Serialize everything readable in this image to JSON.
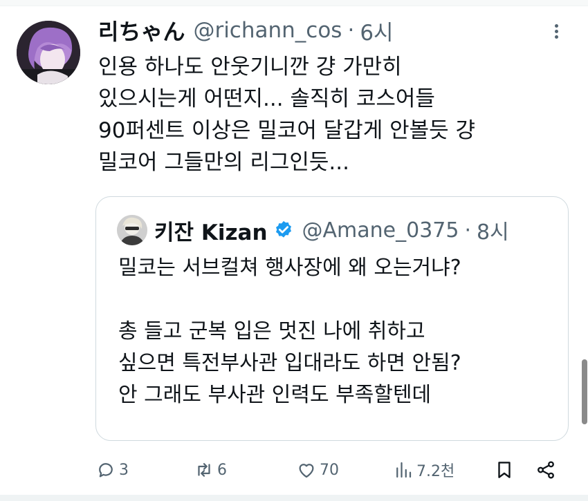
{
  "tweet": {
    "display_name": "리ちゃん",
    "handle": "@richann_cos",
    "separator": "·",
    "time": "6시",
    "lines": [
      "인용 하나도 안웃기니깐 걍 가만히",
      "있으시는게 어떤지... 솔직히 코스어들",
      "90퍼센트 이상은 밀코어 달갑게 안볼듯 걍",
      "밀코어 그들만의 리그인듯..."
    ]
  },
  "quote": {
    "display_name": "키잔 Kizan",
    "handle": "@Amane_0375",
    "separator": "·",
    "time": "8시",
    "lines": [
      "밀코는 서브컬쳐 행사장에 왜 오는거냐?",
      "",
      "총 들고 군복 입은 멋진 나에 취하고",
      "싶으면 특전부사관 입대라도 하면 안됨?",
      "안 그래도 부사관 인력도 부족할텐데"
    ]
  },
  "actions": {
    "replies": "3",
    "retweets": "6",
    "likes": "70",
    "views": "7.2천"
  },
  "colors": {
    "text": "#0f1419",
    "secondary": "#536471",
    "verified": "#1d9bf0",
    "border": "#cfd9de"
  },
  "icons": [
    "more-icon",
    "verified-badge-icon",
    "reply-icon",
    "retweet-icon",
    "like-icon",
    "views-icon",
    "bookmark-icon",
    "share-icon"
  ]
}
